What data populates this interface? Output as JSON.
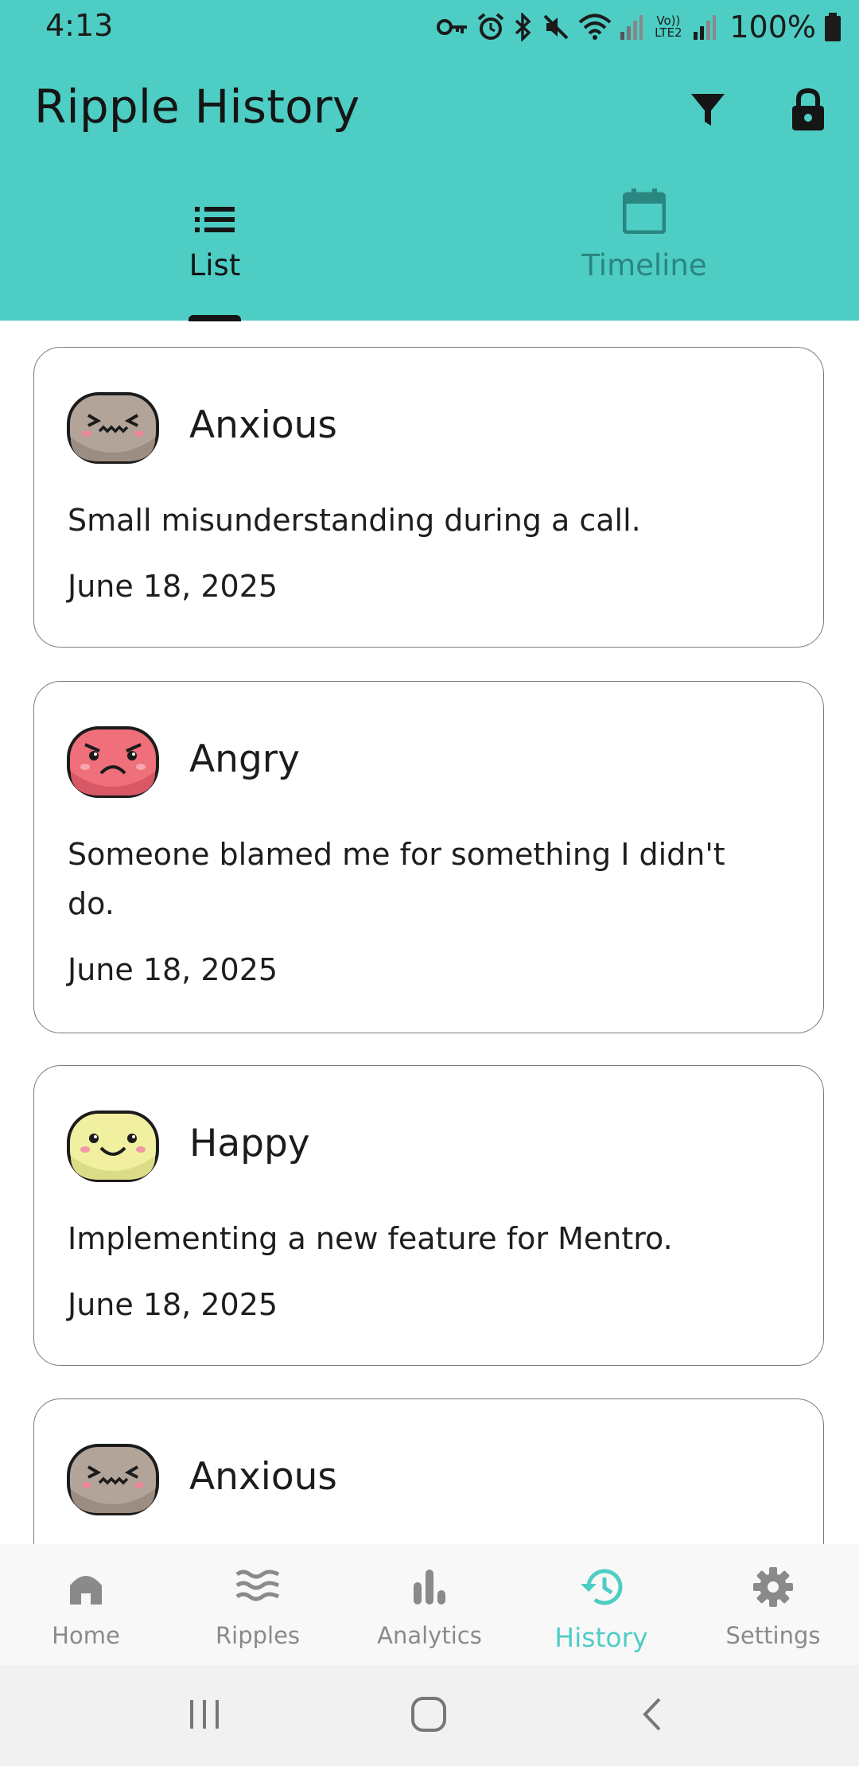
{
  "status_bar": {
    "time": "4:13",
    "battery_percent": "100%",
    "network_label": "Vo)) LTE2"
  },
  "header": {
    "title": "Ripple History",
    "filter_icon": "filter-icon",
    "lock_icon": "lock-icon"
  },
  "tabs": [
    {
      "label": "List",
      "icon": "list-icon",
      "active": true
    },
    {
      "label": "Timeline",
      "icon": "calendar-icon",
      "active": false
    }
  ],
  "entries": [
    {
      "mood": "Anxious",
      "face": "anxious",
      "note": "Small misunderstanding during a call.",
      "date": "June 18, 2025"
    },
    {
      "mood": "Angry",
      "face": "angry",
      "note": "Someone blamed me for something I didn't do.",
      "date": "June 18, 2025"
    },
    {
      "mood": "Happy",
      "face": "happy",
      "note": "Implementing a new feature for Mentro.",
      "date": "June 18, 2025"
    },
    {
      "mood": "Anxious",
      "face": "anxious",
      "note": "",
      "date": ""
    }
  ],
  "bottom_nav": [
    {
      "label": "Home",
      "icon": "home-icon",
      "active": false
    },
    {
      "label": "Ripples",
      "icon": "waves-icon",
      "active": false
    },
    {
      "label": "Analytics",
      "icon": "bar-chart-icon",
      "active": false
    },
    {
      "label": "History",
      "icon": "history-icon",
      "active": true
    },
    {
      "label": "Settings",
      "icon": "gear-icon",
      "active": false
    }
  ],
  "colors": {
    "accent": "#4ecdc4",
    "anxious_face": "#b3a499",
    "angry_face": "#ef6f7a",
    "happy_face": "#f0f0a0"
  }
}
